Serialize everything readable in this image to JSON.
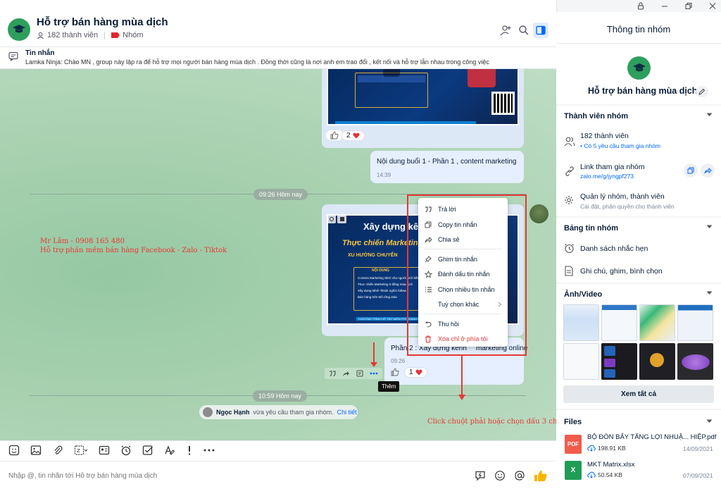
{
  "window": {
    "controls": [
      "lock-icon",
      "minimize-icon",
      "restore-icon",
      "close-icon"
    ]
  },
  "chat": {
    "title": "Hỗ trợ bán hàng mùa dịch",
    "member_count": "182 thành viên",
    "group_tag": "Nhóm",
    "pinned": {
      "title": "Tin nhắn",
      "text": "Lamka Ninja: Chào MN , group này lập ra để hỗ trợ mọi người bán hàng mùa dịch . Đồng thời cũng là nơi anh em trao đổi , kết nối và hỗ trợ lẫn nhau trong công việc"
    },
    "messages": {
      "first_image_reaction_count": "2",
      "text_message": "Nội dung buổi 1 - Phần 1 , content marketing",
      "text_message_time": "14:39",
      "divider_1": "09:26 Hôm nay",
      "poster_title": "Xây dựng kênh",
      "poster_subtitle": "Thực chiến Marketing",
      "poster_trend": "XU HƯỚNG CHUYỂN",
      "poster_section": "NỘI DUNG",
      "poster_items": [
        "Content Marketing SEO cho người mới bắt đầu",
        "Thực chiến Marketing 0 đồng mùa dịch",
        "Xây dựng kênh Tiktok nghìn follow",
        "Bán hàng trên Mô rông Zalo"
      ],
      "poster_footer": "CHƯƠNG TRÌNH HỖ TRỢ MIỄN PHÍ DOANH NGHIỆP VỪA VÀ NHỎ",
      "second_text_prefix": "Phần 2 : Xây dựng kênh",
      "second_text_suffix": "marketing online",
      "second_text_time": "09:26",
      "second_reaction_count": "1",
      "tooltip": "Thêm",
      "divider_2": "10:59 Hôm nay",
      "system_name": "Ngọc Hạnh",
      "system_text": "vừa yêu cầu tham gia nhóm.",
      "system_link": "Chi tiết"
    },
    "annotations": {
      "line1": "Mr Lâm - 0908 165 480",
      "line2": "Hỗ trợ phần mềm bán hàng Facebook - Zalo - Tiktok",
      "bottom": "Click chuột phải hoặc chọn dấu 3 chấm"
    },
    "context_menu": [
      {
        "label": "Trả lời",
        "icon": "quote-icon"
      },
      {
        "label": "Copy tin nhắn",
        "icon": "copy-icon"
      },
      {
        "label": "Chia sẻ",
        "icon": "share-icon"
      },
      {
        "label": "Ghim tin nhắn",
        "icon": "pin-icon"
      },
      {
        "label": "Đánh dấu tin nhắn",
        "icon": "star-icon"
      },
      {
        "label": "Chọn nhiều tin nhắn",
        "icon": "list-icon"
      },
      {
        "label": "Tuỳ chọn khác",
        "icon": ""
      },
      {
        "label": "Thu hồi",
        "icon": "undo-icon"
      },
      {
        "label": "Xóa chỉ ở phía tôi",
        "icon": "trash-icon"
      }
    ],
    "input_placeholder": "Nhập @, tin nhắn tới Hỗ trợ bán hàng mùa dịch"
  },
  "panel": {
    "header": "Thông tin nhóm",
    "group_name": "Hỗ trợ bán hàng mùa dịch",
    "members_section": "Thành viên nhóm",
    "members_count": "182 thành viên",
    "members_pending": "Có 5 yêu cầu tham gia nhóm",
    "link_title": "Link tham gia nhóm",
    "link_url": "zalo.me/g/jyngpf273",
    "manage_title": "Quản lý nhóm, thành viên",
    "manage_sub": "Cài đặt, phân quyền cho thành viên",
    "board_section": "Bảng tin nhóm",
    "reminders": "Danh sách nhắc hẹn",
    "notes": "Ghi chú, ghim, bình chọn",
    "media_section": "Ảnh/Video",
    "see_all": "Xem tất cả",
    "files_section": "Files",
    "files": [
      {
        "name": "BỘ ĐÒN BẨY TĂNG LỢI NHUẬ... HIỆP.pdf",
        "size": "198.91 KB",
        "date": "14/09/2021",
        "type": "PDF"
      },
      {
        "name": "MKT Matrix.xlsx",
        "size": "50.54 KB",
        "date": "07/09/2021",
        "type": "X"
      }
    ]
  },
  "colors": {
    "accent": "#0068ff",
    "annotation": "#e53935",
    "group_avatar": "#2e9e5c"
  }
}
